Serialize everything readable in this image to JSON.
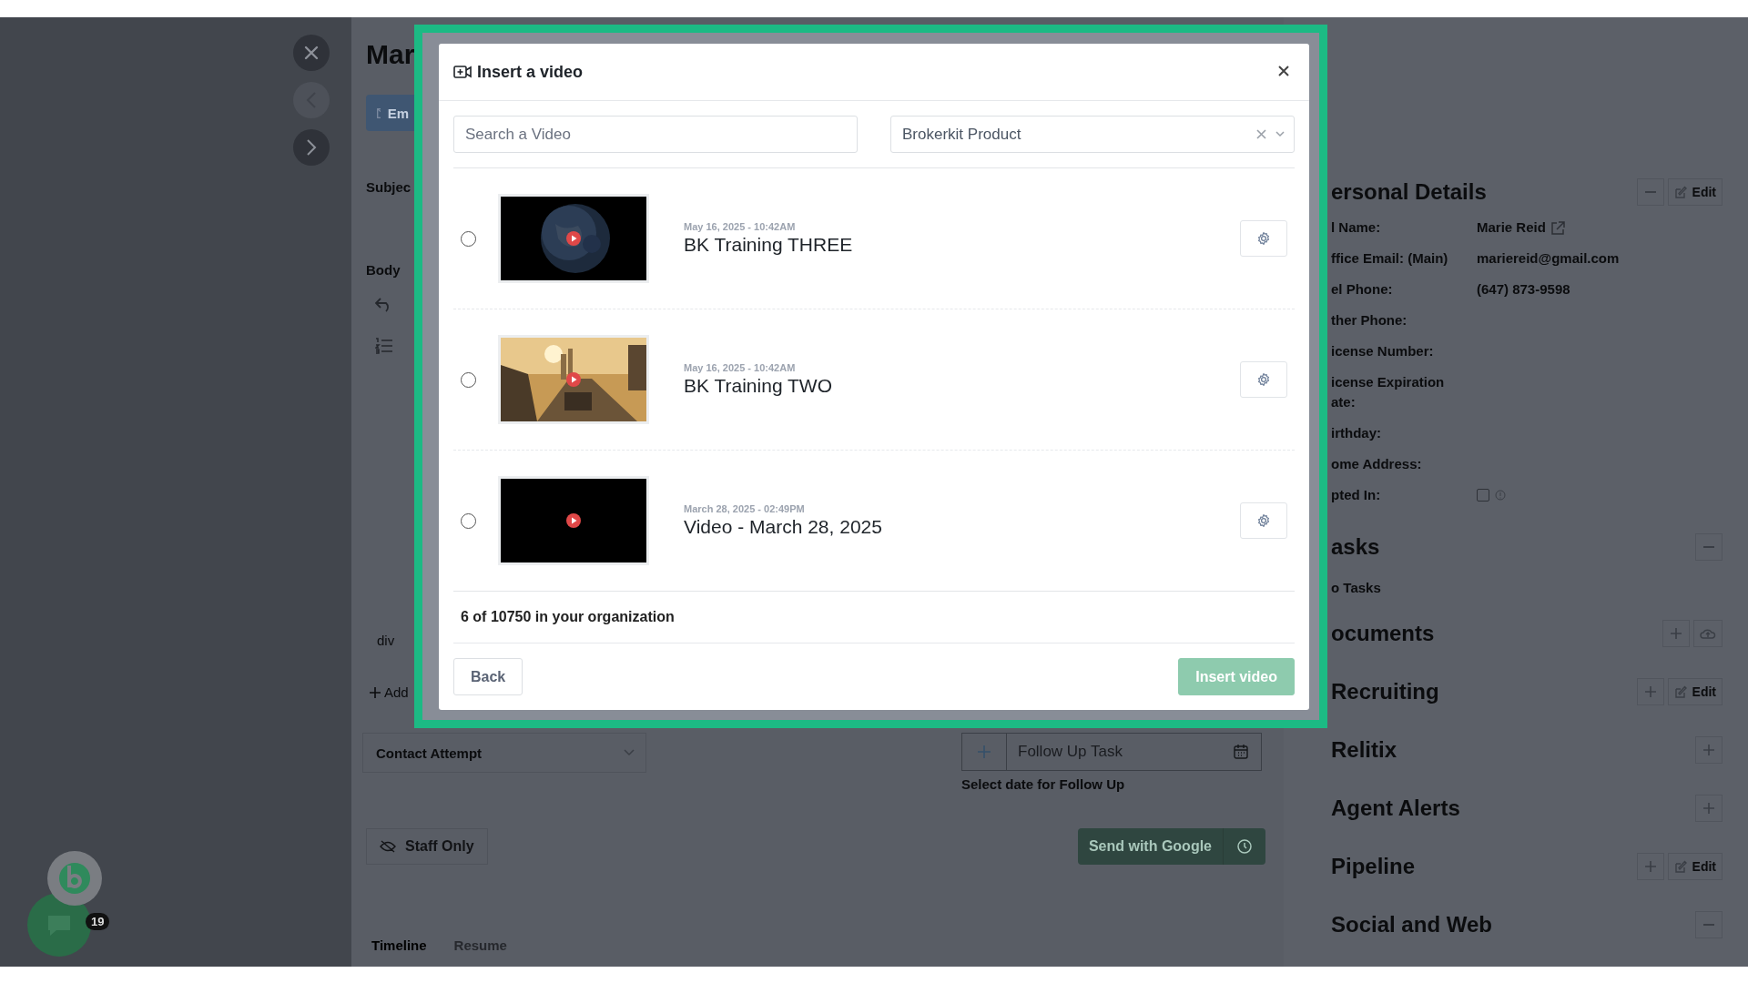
{
  "sidebar": {
    "buttons": [
      {
        "kind": "close"
      },
      {
        "kind": "back"
      },
      {
        "kind": "forward"
      }
    ]
  },
  "chat_widget": {
    "badge": "19"
  },
  "compose": {
    "title": "Mar",
    "email_tab": "Em",
    "subject_label": "Subjec",
    "body_label": "Body",
    "tag": "div",
    "add_label": "Add",
    "contact_select": "Contact Attempt",
    "follow_up": {
      "placeholder": "Follow Up Task"
    },
    "follow_up_hint": "Select date for Follow Up",
    "visibility": "Staff Only",
    "send_button": "Send with Google",
    "tabs": [
      {
        "label": "Timeline",
        "selected": true
      },
      {
        "label": "Resume",
        "selected": false
      }
    ]
  },
  "details": {
    "sections": [
      {
        "title": "ersonal Details",
        "actions": [
          {
            "kind": "minus"
          },
          {
            "kind": "edit",
            "label": "Edit"
          }
        ],
        "fields": [
          {
            "kind": "link",
            "label": "l Name:",
            "value": "Marie Reid"
          },
          {
            "kind": "text",
            "label": "ffice Email: (Main)",
            "value": "mariereid@gmail.com"
          },
          {
            "kind": "text",
            "label": "el Phone:",
            "value": "(647) 873-9598"
          },
          {
            "kind": "text",
            "label": "ther Phone:"
          },
          {
            "kind": "text",
            "label": "icense Number:"
          },
          {
            "kind": "text",
            "label": "icense Expiration ate:"
          },
          {
            "kind": "text",
            "label": "irthday:"
          },
          {
            "kind": "text",
            "label": "ome Address:"
          },
          {
            "kind": "checkbox",
            "label": "pted In:",
            "checked": false
          }
        ]
      },
      {
        "title": "asks",
        "actions": [
          {
            "kind": "minus"
          }
        ],
        "empty_text": "o Tasks"
      },
      {
        "title": "ocuments",
        "actions": [
          {
            "kind": "plus"
          },
          {
            "kind": "upload"
          }
        ]
      },
      {
        "title": "Recruiting",
        "actions": [
          {
            "kind": "plus"
          },
          {
            "kind": "edit",
            "label": "Edit"
          }
        ]
      },
      {
        "title": "Relitix",
        "actions": [
          {
            "kind": "plus"
          }
        ]
      },
      {
        "title": "Agent Alerts",
        "actions": [
          {
            "kind": "plus"
          }
        ]
      },
      {
        "title": "Pipeline",
        "actions": [
          {
            "kind": "plus"
          },
          {
            "kind": "edit",
            "label": "Edit"
          }
        ]
      },
      {
        "title": "Social and Web",
        "actions": [
          {
            "kind": "minus"
          }
        ]
      }
    ]
  },
  "dialog": {
    "title": "Insert a video",
    "search": {
      "placeholder": "Search a Video"
    },
    "category": {
      "value": "Brokerkit Product"
    },
    "videos": [
      {
        "date": "May 16, 2025 - 10:42AM",
        "title": "BK Training THREE",
        "selected": false
      },
      {
        "date": "May 16, 2025 - 10:42AM",
        "title": "BK Training TWO",
        "selected": false
      },
      {
        "date": "March 28, 2025 - 02:49PM",
        "title": "Video - March 28, 2025",
        "selected": false
      }
    ],
    "count": "6 of 10750 in your organization",
    "buttons": [
      {
        "kind": "secondary",
        "label": "Back",
        "disabled": false
      },
      {
        "kind": "primary",
        "label": "Insert video",
        "disabled": true
      }
    ]
  }
}
